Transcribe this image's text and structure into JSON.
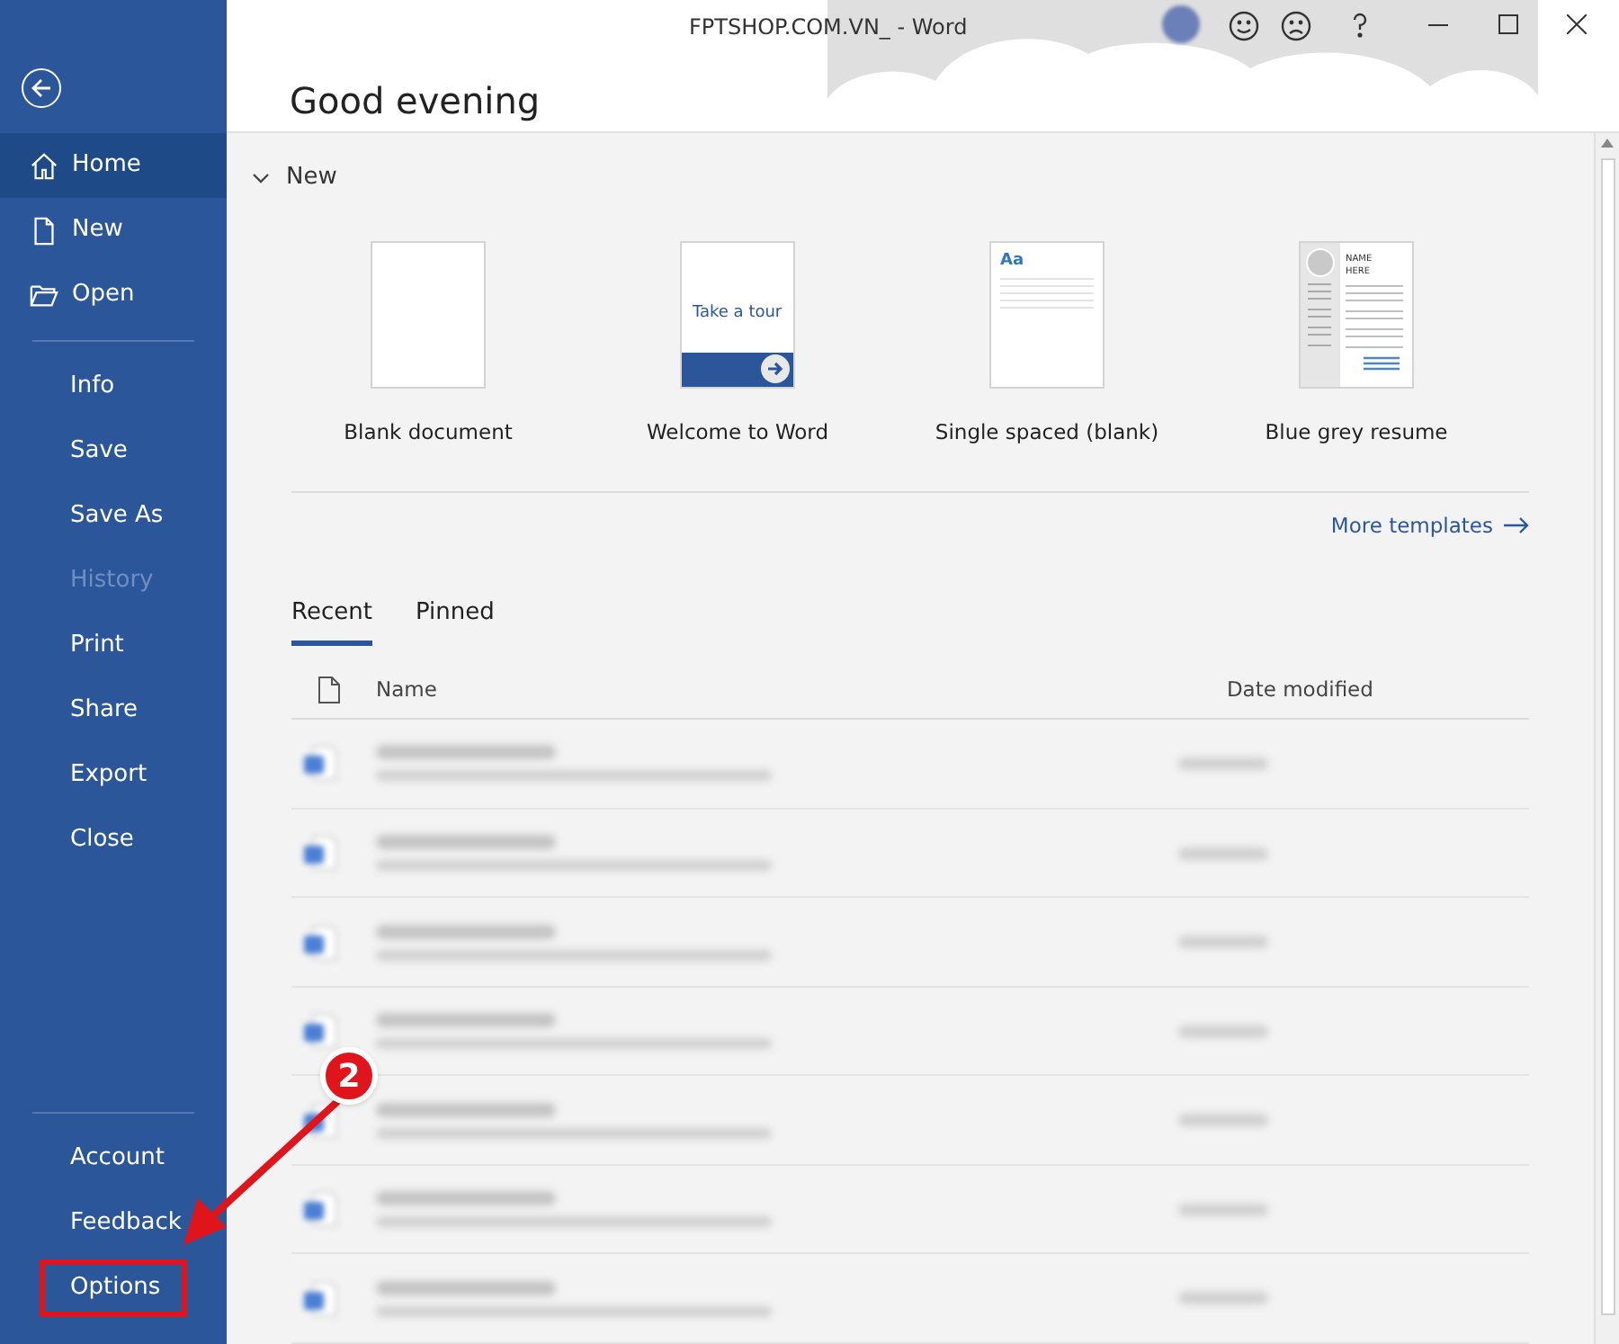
{
  "window": {
    "title": "FPTSHOP.COM.VN_  -  Word"
  },
  "sidebar": {
    "top_items": [
      {
        "label": "Home",
        "kind": "home",
        "selected": true,
        "disabled": false,
        "highlighted": false
      },
      {
        "label": "New",
        "kind": "file",
        "selected": false,
        "disabled": false,
        "highlighted": false
      },
      {
        "label": "Open",
        "kind": "folder",
        "selected": false,
        "disabled": false,
        "highlighted": false
      }
    ],
    "middle_items": [
      {
        "label": "Info",
        "kind": "plain",
        "selected": false,
        "disabled": false,
        "highlighted": false
      },
      {
        "label": "Save",
        "kind": "plain",
        "selected": false,
        "disabled": false,
        "highlighted": false
      },
      {
        "label": "Save As",
        "kind": "plain",
        "selected": false,
        "disabled": false,
        "highlighted": false
      },
      {
        "label": "History",
        "kind": "plain",
        "selected": false,
        "disabled": true,
        "highlighted": false
      },
      {
        "label": "Print",
        "kind": "plain",
        "selected": false,
        "disabled": false,
        "highlighted": false
      },
      {
        "label": "Share",
        "kind": "plain",
        "selected": false,
        "disabled": false,
        "highlighted": false
      },
      {
        "label": "Export",
        "kind": "plain",
        "selected": false,
        "disabled": false,
        "highlighted": false
      },
      {
        "label": "Close",
        "kind": "plain",
        "selected": false,
        "disabled": false,
        "highlighted": false
      }
    ],
    "bottom_items": [
      {
        "label": "Account",
        "kind": "plain",
        "selected": false,
        "disabled": false,
        "highlighted": false
      },
      {
        "label": "Feedback",
        "kind": "plain",
        "selected": false,
        "disabled": false,
        "highlighted": false
      },
      {
        "label": "Options",
        "kind": "plain",
        "selected": false,
        "disabled": false,
        "highlighted": true
      }
    ]
  },
  "greeting": "Good evening",
  "new_section": {
    "title": "New",
    "expanded": true,
    "templates": [
      {
        "label": "Blank document",
        "kind": "blank"
      },
      {
        "label": "Welcome to Word",
        "kind": "tour",
        "thumb_text": "Take a tour"
      },
      {
        "label": "Single spaced (blank)",
        "kind": "lined",
        "thumb_text": "Aa"
      },
      {
        "label": "Blue grey resume",
        "kind": "resume",
        "thumb_text": "NAME HERE"
      }
    ],
    "more_link": "More templates"
  },
  "tabs": [
    {
      "label": "Recent",
      "selected": true
    },
    {
      "label": "Pinned",
      "selected": false
    }
  ],
  "table": {
    "columns": [
      "Name",
      "Date modified"
    ],
    "rows": [
      {
        "kind": "blurred"
      },
      {
        "kind": "blurred"
      },
      {
        "kind": "blurred"
      },
      {
        "kind": "blurred"
      },
      {
        "kind": "blurred"
      },
      {
        "kind": "blurred"
      },
      {
        "kind": "blurred"
      }
    ]
  },
  "annotation": {
    "badge": "2"
  }
}
